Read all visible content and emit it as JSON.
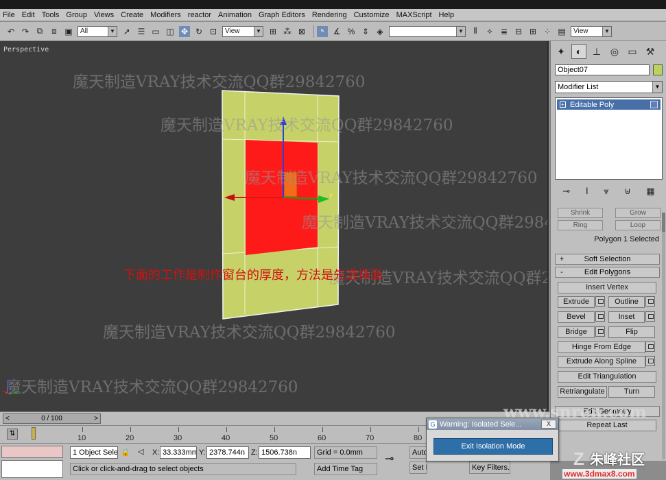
{
  "menu": [
    "File",
    "Edit",
    "Tools",
    "Group",
    "Views",
    "Create",
    "Modifiers",
    "reactor",
    "Animation",
    "Graph Editors",
    "Rendering",
    "Customize",
    "MAXScript",
    "Help"
  ],
  "toolbar": {
    "selection_filter": "All",
    "ref_coord": "View",
    "named_sel": "",
    "render_type": "View"
  },
  "viewport": {
    "label": "Perspective",
    "watermark": "魔天制造VRAY技术交流QQ群29842760",
    "caption": "下面的工作是制作窗台的厚度，方法是先选择面",
    "gizmo_axes": {
      "x": "x",
      "y": "y",
      "z": "z"
    }
  },
  "command_panel": {
    "object_name": "Object07",
    "object_color": "#bcd35b",
    "modifier_list": "Modifier List",
    "stack": [
      {
        "label": "Editable Poly",
        "expand": "+"
      }
    ],
    "selection": {
      "shrink": "Shrink",
      "grow": "Grow",
      "ring": "Ring",
      "loop": "Loop",
      "status": "Polygon 1 Selected"
    },
    "soft_selection": {
      "sign": "+",
      "label": "Soft Selection"
    },
    "edit_polygons": {
      "sign": "-",
      "label": "Edit Polygons",
      "insert_vertex": "Insert Vertex",
      "extrude": "Extrude",
      "outline": "Outline",
      "bevel": "Bevel",
      "inset": "Inset",
      "bridge": "Bridge",
      "flip": "Flip",
      "hinge_from_edge": "Hinge From Edge",
      "extrude_along_spline": "Extrude Along Spline",
      "edit_triangulation": "Edit Triangulation",
      "retriangulate": "Retriangulate",
      "turn": "Turn"
    },
    "edit_geometry": {
      "label": "Edit Geometry",
      "repeat_last": "Repeat Last"
    }
  },
  "timeline": {
    "position": "0 / 100",
    "ticks": [
      "10",
      "20",
      "30",
      "40",
      "50",
      "60",
      "70",
      "80"
    ]
  },
  "status_bar": {
    "selected": "1 Object Sele",
    "x_label": "X:",
    "x": "33.333mm",
    "y_label": "Y:",
    "y": "2378.744n",
    "z_label": "Z:",
    "z": "1506.738n",
    "grid": "Grid = 0.0mm",
    "prompt": "Click or click-and-drag to select objects",
    "add_time_tag": "Add Time Tag",
    "auto_key": "Auto",
    "set_key": "Set Key",
    "key_filters": "Key Filters..."
  },
  "warning_dialog": {
    "title": "Warning: Isolated Sele...",
    "close": "X",
    "button": "Exit Isolation Mode"
  },
  "brand": {
    "site": "www.snren.com",
    "logo_text": "朱峰社区",
    "logo_url": "www.3dmax8.com"
  }
}
